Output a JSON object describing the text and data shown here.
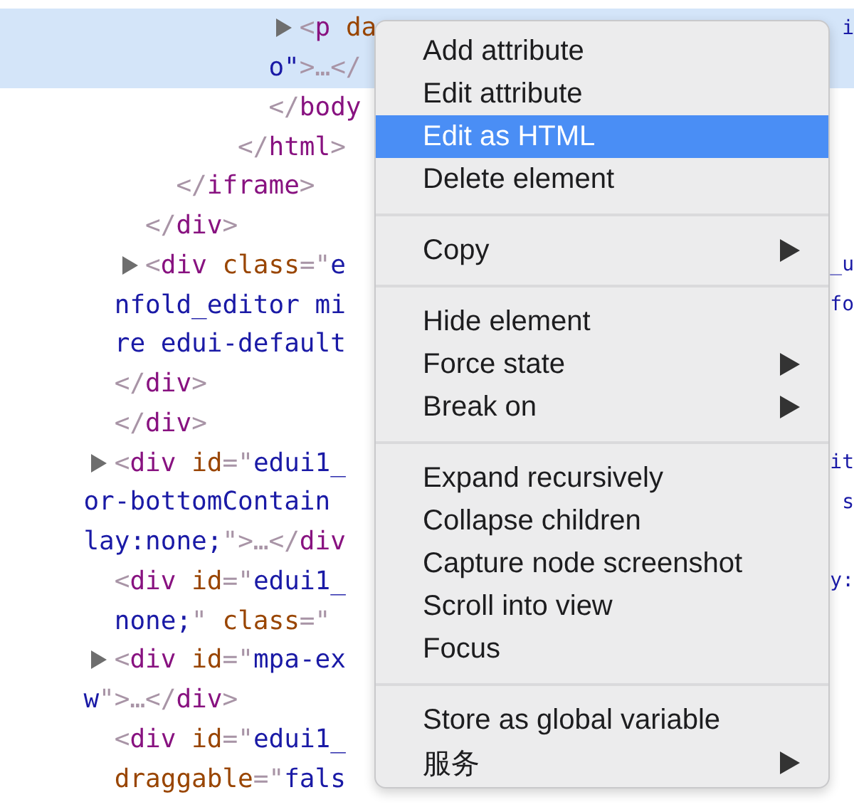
{
  "elements_panel": {
    "lines": [
      {
        "selected": true,
        "expander": true,
        "segments": [
          {
            "kind": "punct",
            "text": "              <"
          },
          {
            "kind": "tag",
            "text": "p "
          },
          {
            "kind": "attr",
            "text": "da"
          }
        ],
        "right": "i"
      },
      {
        "selected": true,
        "expander": false,
        "segments": [
          {
            "kind": "value",
            "text": "              o\""
          },
          {
            "kind": "punct",
            "text": ">…</"
          }
        ]
      },
      {
        "selected": false,
        "expander": false,
        "segments": [
          {
            "kind": "punct",
            "text": "              </"
          },
          {
            "kind": "tag",
            "text": "body"
          }
        ]
      },
      {
        "selected": false,
        "expander": false,
        "segments": [
          {
            "kind": "punct",
            "text": "            </"
          },
          {
            "kind": "tag",
            "text": "html"
          },
          {
            "kind": "punct",
            "text": ">"
          }
        ]
      },
      {
        "selected": false,
        "expander": false,
        "segments": [
          {
            "kind": "punct",
            "text": "        </"
          },
          {
            "kind": "tag",
            "text": "iframe"
          },
          {
            "kind": "punct",
            "text": ">"
          }
        ]
      },
      {
        "selected": false,
        "expander": false,
        "segments": [
          {
            "kind": "punct",
            "text": "      </"
          },
          {
            "kind": "tag",
            "text": "div"
          },
          {
            "kind": "punct",
            "text": ">"
          }
        ]
      },
      {
        "selected": false,
        "expander": true,
        "segments": [
          {
            "kind": "punct",
            "text": "    <"
          },
          {
            "kind": "tag",
            "text": "div "
          },
          {
            "kind": "attr",
            "text": "class"
          },
          {
            "kind": "punct",
            "text": "=\""
          },
          {
            "kind": "value",
            "text": "e"
          }
        ],
        "right": "_u"
      },
      {
        "selected": false,
        "expander": false,
        "segments": [
          {
            "kind": "value",
            "text": "    nfold_editor mi"
          }
        ],
        "right": "fo"
      },
      {
        "selected": false,
        "expander": false,
        "segments": [
          {
            "kind": "value",
            "text": "    re edui-default"
          }
        ]
      },
      {
        "selected": false,
        "expander": false,
        "segments": [
          {
            "kind": "punct",
            "text": "    </"
          },
          {
            "kind": "tag",
            "text": "div"
          },
          {
            "kind": "punct",
            "text": ">"
          }
        ]
      },
      {
        "selected": false,
        "expander": false,
        "segments": [
          {
            "kind": "punct",
            "text": "    </"
          },
          {
            "kind": "tag",
            "text": "div"
          },
          {
            "kind": "punct",
            "text": ">"
          }
        ]
      },
      {
        "selected": false,
        "expander": true,
        "segments": [
          {
            "kind": "punct",
            "text": "  <"
          },
          {
            "kind": "tag",
            "text": "div "
          },
          {
            "kind": "attr",
            "text": "id"
          },
          {
            "kind": "punct",
            "text": "=\""
          },
          {
            "kind": "value",
            "text": "edui1_"
          }
        ],
        "right": "it"
      },
      {
        "selected": false,
        "expander": false,
        "segments": [
          {
            "kind": "value",
            "text": "  or-bottomContain"
          }
        ],
        "right": "s"
      },
      {
        "selected": false,
        "expander": false,
        "segments": [
          {
            "kind": "value",
            "text": "  lay:none;"
          },
          {
            "kind": "punct",
            "text": "\">…</"
          },
          {
            "kind": "tag",
            "text": "div"
          }
        ]
      },
      {
        "selected": false,
        "expander": false,
        "segments": [
          {
            "kind": "punct",
            "text": "    <"
          },
          {
            "kind": "tag",
            "text": "div "
          },
          {
            "kind": "attr",
            "text": "id"
          },
          {
            "kind": "punct",
            "text": "=\""
          },
          {
            "kind": "value",
            "text": "edui1_"
          }
        ],
        "right": "y:"
      },
      {
        "selected": false,
        "expander": false,
        "segments": [
          {
            "kind": "value",
            "text": "    none;"
          },
          {
            "kind": "punct",
            "text": "\" "
          },
          {
            "kind": "attr",
            "text": "class"
          },
          {
            "kind": "punct",
            "text": "=\""
          }
        ]
      },
      {
        "selected": false,
        "expander": true,
        "segments": [
          {
            "kind": "punct",
            "text": "  <"
          },
          {
            "kind": "tag",
            "text": "div "
          },
          {
            "kind": "attr",
            "text": "id"
          },
          {
            "kind": "punct",
            "text": "=\""
          },
          {
            "kind": "value",
            "text": "mpa-ex"
          }
        ]
      },
      {
        "selected": false,
        "expander": false,
        "segments": [
          {
            "kind": "value",
            "text": "  w"
          },
          {
            "kind": "punct",
            "text": "\">…</"
          },
          {
            "kind": "tag",
            "text": "div"
          },
          {
            "kind": "punct",
            "text": ">"
          }
        ]
      },
      {
        "selected": false,
        "expander": false,
        "segments": [
          {
            "kind": "punct",
            "text": "    <"
          },
          {
            "kind": "tag",
            "text": "div "
          },
          {
            "kind": "attr",
            "text": "id"
          },
          {
            "kind": "punct",
            "text": "=\""
          },
          {
            "kind": "value",
            "text": "edui1_"
          }
        ]
      },
      {
        "selected": false,
        "expander": false,
        "segments": [
          {
            "kind": "attr",
            "text": "    draggable"
          },
          {
            "kind": "punct",
            "text": "=\""
          },
          {
            "kind": "value",
            "text": "fals"
          }
        ]
      }
    ]
  },
  "context_menu": {
    "groups": [
      {
        "items": [
          {
            "label": "Add attribute",
            "submenu": false,
            "selected": false
          },
          {
            "label": "Edit attribute",
            "submenu": false,
            "selected": false
          },
          {
            "label": "Edit as HTML",
            "submenu": false,
            "selected": true
          },
          {
            "label": "Delete element",
            "submenu": false,
            "selected": false
          }
        ]
      },
      {
        "items": [
          {
            "label": "Copy",
            "submenu": true,
            "selected": false
          }
        ]
      },
      {
        "items": [
          {
            "label": "Hide element",
            "submenu": false,
            "selected": false
          },
          {
            "label": "Force state",
            "submenu": true,
            "selected": false
          },
          {
            "label": "Break on",
            "submenu": true,
            "selected": false
          }
        ]
      },
      {
        "items": [
          {
            "label": "Expand recursively",
            "submenu": false,
            "selected": false
          },
          {
            "label": "Collapse children",
            "submenu": false,
            "selected": false
          },
          {
            "label": "Capture node screenshot",
            "submenu": false,
            "selected": false
          },
          {
            "label": "Scroll into view",
            "submenu": false,
            "selected": false
          },
          {
            "label": "Focus",
            "submenu": false,
            "selected": false
          }
        ]
      },
      {
        "items": [
          {
            "label": "Store as global variable",
            "submenu": false,
            "selected": false
          },
          {
            "label": "服务",
            "submenu": true,
            "selected": false
          }
        ]
      }
    ]
  }
}
